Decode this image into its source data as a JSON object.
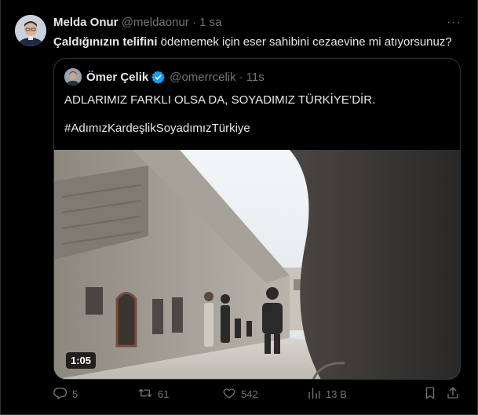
{
  "tweet": {
    "author_name": "Melda Onur",
    "author_handle": "@meldaonur",
    "separator": "·",
    "time": "1 sa",
    "text_bold": "Çaldığınızın telifini",
    "text_rest": " ödememek için eser sahibini cezaevine mi atıyorsunuz?"
  },
  "quoted": {
    "author_name": "Ömer Çelik",
    "author_handle": "@omerrcelik",
    "separator": "·",
    "time": "11s",
    "text_line1": "ADLARIMIZ FARKLI OLSA DA, SOYADIMIZ TÜRKİYE’DİR.",
    "text_line2": "#AdımızKardeşlikSoyadımızTürkiye",
    "video_duration": "1:05"
  },
  "actions": {
    "reply_count": "5",
    "retweet_count": "61",
    "like_count": "542",
    "views_count": "13 B"
  },
  "icons": {
    "more": "more-horizontal-icon",
    "verified": "verified-badge-icon",
    "reply": "reply-icon",
    "retweet": "retweet-icon",
    "like": "heart-icon",
    "views": "views-icon",
    "bookmark": "bookmark-icon",
    "share": "share-icon"
  },
  "colors": {
    "background": "#000000",
    "text": "#e7e9ea",
    "muted": "#71767b",
    "border": "#2f3336",
    "verified": "#1d9bf0"
  }
}
